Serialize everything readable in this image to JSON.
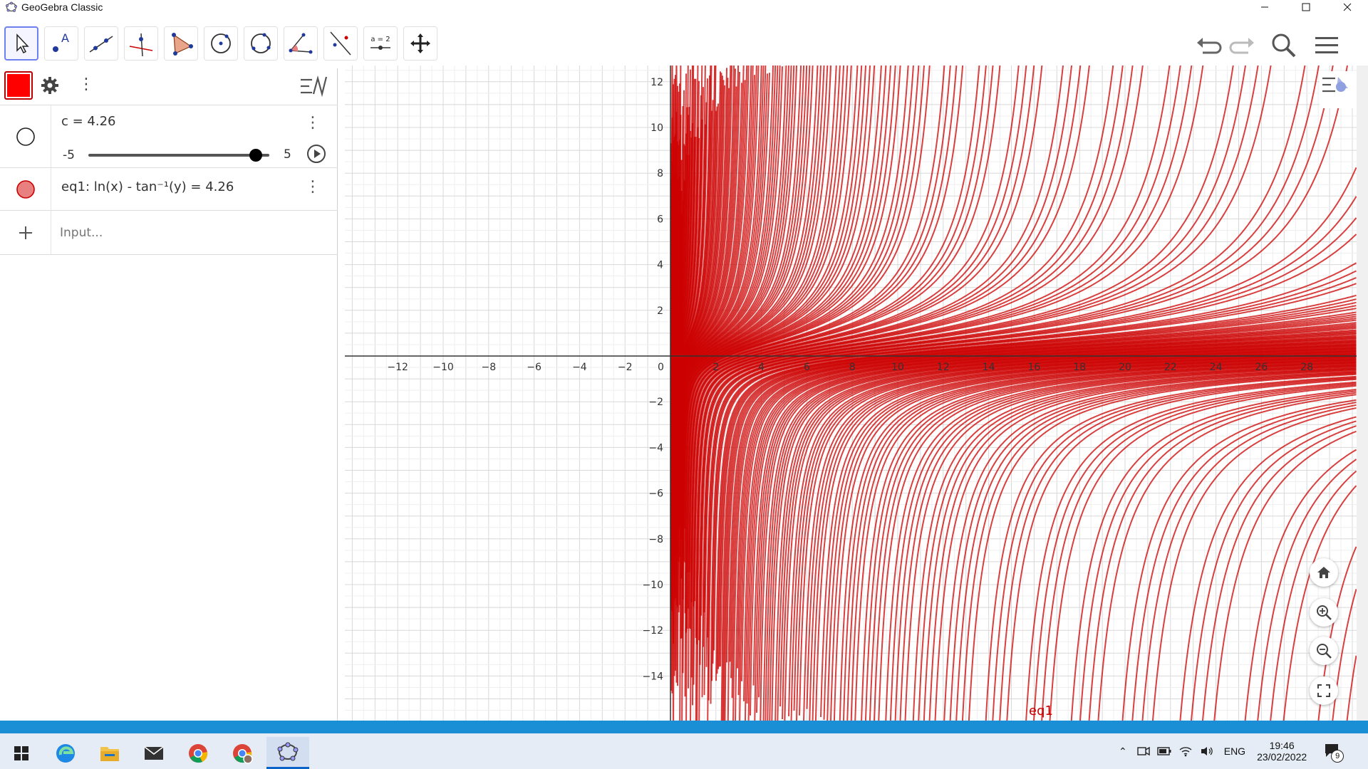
{
  "window": {
    "title": "GeoGebra Classic",
    "controls": [
      "minimize-icon",
      "maximize-icon",
      "close-icon"
    ]
  },
  "toolbar": {
    "tools": [
      "move",
      "point",
      "line",
      "perpendicular-line",
      "polygon",
      "circle-center-point",
      "circle-three-points",
      "angle",
      "reflect",
      "slider",
      "move-graphics-view"
    ],
    "slider_tool_label": "a = 2",
    "right_tools": [
      "undo",
      "redo",
      "search",
      "menu"
    ]
  },
  "algebra": {
    "accent_color": "#ff0000",
    "items": [
      {
        "text": "c = 4.26",
        "slider_min": "-5",
        "slider_max": "5",
        "slider_value": 4.26
      },
      {
        "text": "eq1: ln(x) - tan⁻¹(y) = 4.26",
        "marker_color": "#e88080"
      }
    ],
    "input_placeholder": "Input..."
  },
  "graph": {
    "curve_color": "#cc0000",
    "curve_label": "eq1",
    "x_ticks": [
      "−12",
      "−10",
      "−8",
      "−6",
      "−4",
      "−2",
      "0",
      "2",
      "4",
      "6",
      "8",
      "10",
      "12",
      "14",
      "16",
      "18",
      "20",
      "22",
      "24",
      "26",
      "28"
    ],
    "y_ticks": [
      "12",
      "10",
      "8",
      "6",
      "4",
      "2",
      "−2",
      "−4",
      "−6",
      "−8",
      "−10",
      "−12",
      "−14"
    ],
    "nav_buttons": [
      "home-icon",
      "zoom-in-icon",
      "zoom-out-icon",
      "fullscreen-icon"
    ]
  },
  "taskbar": {
    "apps": [
      "windows-start",
      "edge",
      "file-explorer",
      "mail",
      "chrome",
      "chrome-profile",
      "geogebra"
    ],
    "tray": {
      "language": "ENG",
      "time": "19:46",
      "date": "23/02/2022",
      "notifications": "9"
    }
  }
}
